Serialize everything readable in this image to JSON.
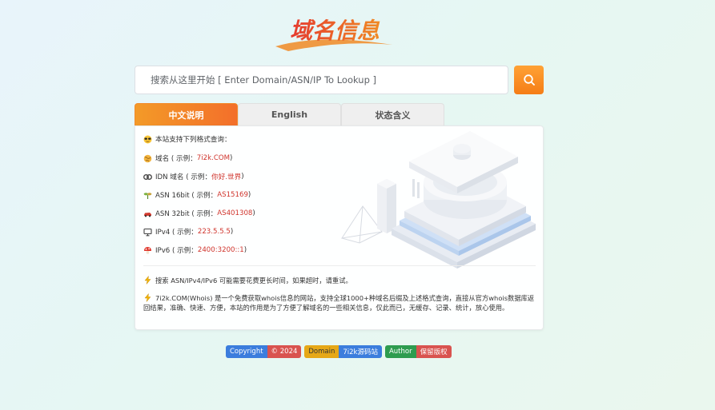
{
  "logo": {
    "text": "域名信息"
  },
  "search": {
    "placeholder": "搜索从这里开始 [ Enter Domain/ASN/IP To Lookup ]",
    "button_icon": "search-icon"
  },
  "tabs": [
    {
      "label": "中文说明",
      "active": true
    },
    {
      "label": "English",
      "active": false
    },
    {
      "label": "状态含义",
      "active": false
    }
  ],
  "info": {
    "intro": "本站支持下列格式查询：",
    "items": [
      {
        "icon": "globe-icon",
        "label": "域名 ( 示例：",
        "example": "7i2k.COM",
        "suffix": " )"
      },
      {
        "icon": "link-icon",
        "label": "IDN 域名 ( 示例：",
        "example": "你好.世界",
        "suffix": " )"
      },
      {
        "icon": "plant-icon",
        "label": "ASN 16bit ( 示例：",
        "example": "AS15169",
        "suffix": " )"
      },
      {
        "icon": "car-icon",
        "label": "ASN 32bit ( 示例：",
        "example": "AS401308",
        "suffix": " )"
      },
      {
        "icon": "monitor-icon",
        "label": "IPv4 ( 示例：",
        "example": "223.5.5.5",
        "suffix": " )"
      },
      {
        "icon": "mushroom-icon",
        "label": "IPv6 ( 示例：",
        "example": "2400:3200::1",
        "suffix": " )"
      }
    ],
    "note1": "搜索 ASN/IPv4/IPv6 可能需要花费更长时间，如果超时，请重试。",
    "note2": "7i2k.COM(Whois) 是一个免费获取whois信息的网站，支持全球1000+种域名后缀及上述格式查询，直接从官方whois数据库返回结果，准确、快速、方便，本站的作用是为了方便了解域名的一些相关信息，仅此而已，无缓存、记录、统计，放心使用。"
  },
  "badges": [
    {
      "left": "Copyright",
      "right": "© 2024",
      "left_color": "#3b7ddd",
      "right_color": "#d9534f"
    },
    {
      "left": "Domain",
      "right": "7i2k源码站",
      "left_color": "#e6a817",
      "right_color": "#3b7ddd"
    },
    {
      "left": "Author",
      "right": "保留版权",
      "left_color": "#2e9c4f",
      "right_color": "#d9534f"
    }
  ],
  "colors": {
    "accent": "#f57d16",
    "example_red": "#d0342c"
  }
}
